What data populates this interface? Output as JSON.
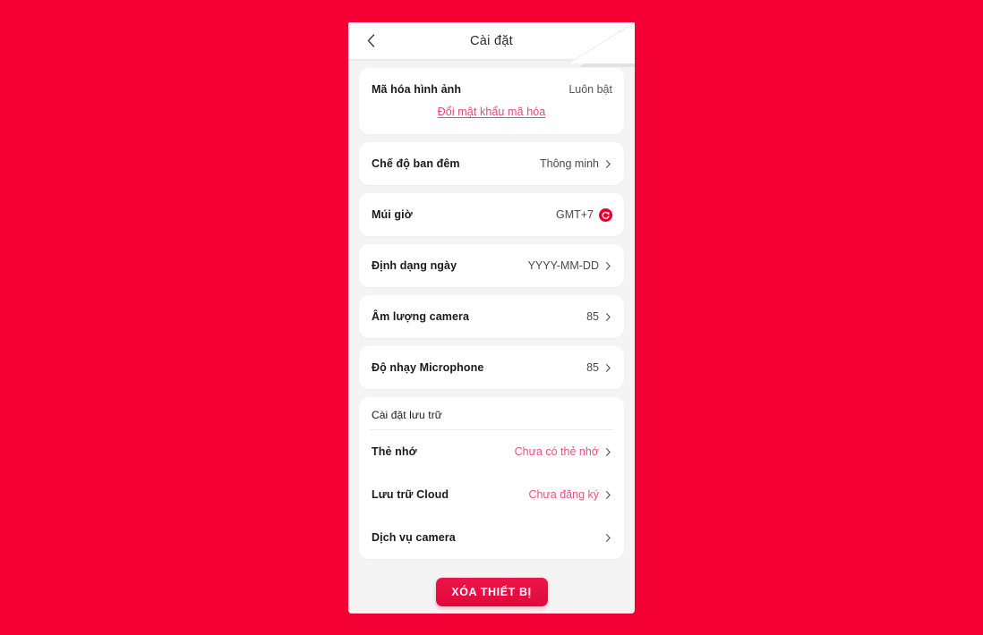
{
  "theme": {
    "page_background": "#F40034",
    "panel_background": "#F4F4F4",
    "card_background": "#FFFFFF",
    "accent_pink": "#E5547C",
    "link_pink": "#E2497A",
    "button_red": "#E0093E",
    "sync_icon_red": "#E4002B",
    "text_primary": "#1A1A1A",
    "text_secondary": "#4A4A4A"
  },
  "header": {
    "title": "Cài đặt",
    "back_icon": "chevron-left-icon",
    "overflow_icon": "more-vertical-icon"
  },
  "settings": {
    "encryption": {
      "label": "Mã hóa hình ảnh",
      "value": "Luôn bật",
      "link": "Đổi mật khẩu mã hóa"
    },
    "rows": [
      {
        "name": "night-mode",
        "label": "Chế độ ban đêm",
        "value": "Thông minh",
        "chevron": true,
        "icon": null,
        "accent": false
      },
      {
        "name": "timezone",
        "label": "Múi giờ",
        "value": "GMT+7",
        "chevron": false,
        "icon": "sync-icon",
        "accent": false
      },
      {
        "name": "date-format",
        "label": "Định dạng ngày",
        "value": "YYYY-MM-DD",
        "chevron": true,
        "icon": null,
        "accent": false
      },
      {
        "name": "camera-volume",
        "label": "Âm lượng camera",
        "value": "85",
        "chevron": true,
        "icon": null,
        "accent": false
      },
      {
        "name": "microphone-sensitivity",
        "label": "Độ nhạy Microphone",
        "value": "85",
        "chevron": true,
        "icon": null,
        "accent": false
      }
    ],
    "storage": {
      "header": "Cài đặt lưu trữ",
      "rows": [
        {
          "name": "memory-card",
          "label": "Thẻ nhớ",
          "value": "Chưa có thẻ nhớ",
          "accent": true
        },
        {
          "name": "cloud-storage",
          "label": "Lưu trữ Cloud",
          "value": "Chưa đăng ký",
          "accent": true
        },
        {
          "name": "camera-service",
          "label": "Dịch vụ camera",
          "value": "",
          "accent": false
        }
      ]
    },
    "delete_button": "XÓA THIẾT BỊ"
  }
}
